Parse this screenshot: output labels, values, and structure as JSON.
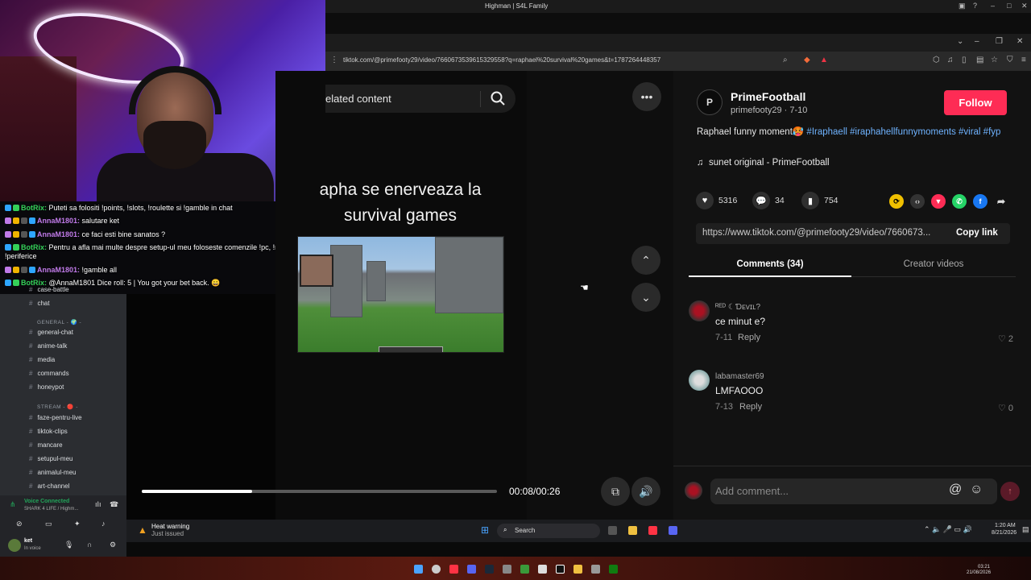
{
  "window": {
    "title": "Highman | S4L Family"
  },
  "browser": {
    "url": "tiktok.com/@primefooty29/video/7660673539615329558?q=raphael%20survival%20games&t=1787264448357"
  },
  "chat": {
    "messages": [
      {
        "user": "BotRix:",
        "text": " Puteti sa folositi !points, !slots, !roulette si !gamble in chat",
        "color": "#34d058"
      },
      {
        "user": "AnnaM1801:",
        "text": " salutare ket",
        "color": "#c07ae8"
      },
      {
        "user": "AnnaM1801:",
        "text": " ce faci esti bine sanatos ?",
        "color": "#c07ae8"
      },
      {
        "user": "BotRix:",
        "text": " Pentru a afla mai multe despre setup-ul meu foloseste comenzile !pc, !monitoare si !periferice",
        "color": "#34d058"
      },
      {
        "user": "AnnaM1801:",
        "text": " !gamble all",
        "color": "#c07ae8"
      },
      {
        "user": "BotRix:",
        "text": " @AnnaM1801 Dice roll: 5 | You got your bet back. 😀",
        "color": "#34d058"
      }
    ]
  },
  "discord": {
    "channels_top": [
      "case-battle",
      "chat"
    ],
    "category_general": "GENERAL - 🌍 -",
    "channels_general": [
      "general-chat",
      "anime-talk",
      "media",
      "commands",
      "honeypot"
    ],
    "category_stream": "STREAM - 🔴 -",
    "channels_stream": [
      "faze-pentru-live",
      "tiktok-clips",
      "mancare",
      "setupul-meu",
      "animalul-meu",
      "art-channel"
    ],
    "voice_status": "Voice Connected",
    "voice_channel": "SHARK 4 LIFE / Highm...",
    "user": "ket",
    "user_status": "In voice"
  },
  "video": {
    "search_label": "elated content",
    "caption": "apha se enerveaza la survival games",
    "time": "00:08/00:26",
    "progress": 0.31
  },
  "post": {
    "author": "PrimeFootball",
    "handle": "primefooty29 · 7-10",
    "follow_label": "Follow",
    "desc_text": "Raphael funny moment🥵 ",
    "hashtags": "#Iraphaell #iraphahellfunnymoments #viral #fyp",
    "sound": "sunet original - PrimeFootball",
    "likes": "5316",
    "comments_count": "34",
    "saves": "754",
    "link": "https://www.tiktok.com/@primefooty29/video/7660673...",
    "copy_label": "Copy link",
    "tab_comments": "Comments (34)",
    "tab_creator": "Creator videos"
  },
  "comments": [
    {
      "user": "ᴿᴱᴰ ☾Ɗᴇᴠɪʟ?",
      "text": "ce minut e?",
      "date": "7-11",
      "reply": "Reply",
      "likes": "2"
    },
    {
      "user": "labamaster69",
      "text": "LMFAOOO",
      "date": "7-13",
      "reply": "Reply",
      "likes": "0"
    }
  ],
  "add_comment": {
    "placeholder": "Add comment..."
  },
  "taskbar": {
    "warning_title": "Heat warning",
    "warning_sub": "Just issued",
    "search": "Search",
    "time": "1:20 AM",
    "date": "8/21/2026",
    "time2": "03:21",
    "date2": "21/08/2026"
  },
  "colors": {
    "accent": "#fe2c55",
    "hashtag": "#6fb3ff",
    "bot": "#34d058",
    "user": "#c07ae8"
  }
}
